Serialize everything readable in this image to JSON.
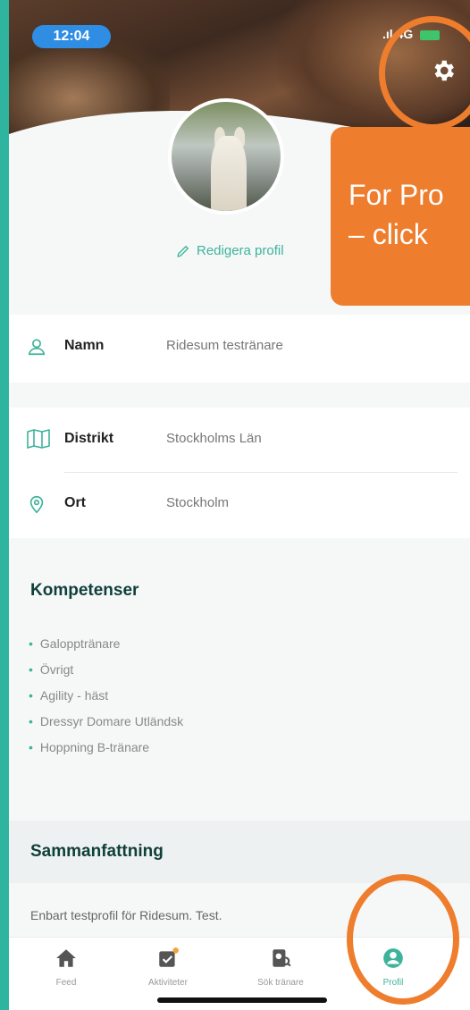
{
  "status_bar": {
    "time": "12:04",
    "network": "4G"
  },
  "header": {
    "edit_label": "Redigera profil"
  },
  "callout": {
    "line1": "For Pro",
    "line2": "– click"
  },
  "personal": {
    "name_label": "Namn",
    "name_value": "Ridesum testränare"
  },
  "location": {
    "district_label": "Distrikt",
    "district_value": "Stockholms Län",
    "city_label": "Ort",
    "city_value": "Stockholm"
  },
  "competences": {
    "title": "Kompetenser",
    "items": [
      "Galopptränare",
      "Övrigt",
      "Agility - häst",
      "Dressyr Domare Utländsk",
      "Hoppning B-tränare"
    ]
  },
  "summary": {
    "title": "Sammanfattning",
    "text": "Enbart testprofil för Ridesum. Test."
  },
  "tabs": [
    {
      "label": "Feed",
      "icon": "home-icon"
    },
    {
      "label": "Aktiviteter",
      "icon": "calendar-check-icon"
    },
    {
      "label": "Sök tränare",
      "icon": "search-trainer-icon"
    },
    {
      "label": "Profil",
      "icon": "profile-icon"
    }
  ],
  "colors": {
    "accent": "#3db39b",
    "callout": "#ee7d2d",
    "background": "#2fb59f"
  }
}
